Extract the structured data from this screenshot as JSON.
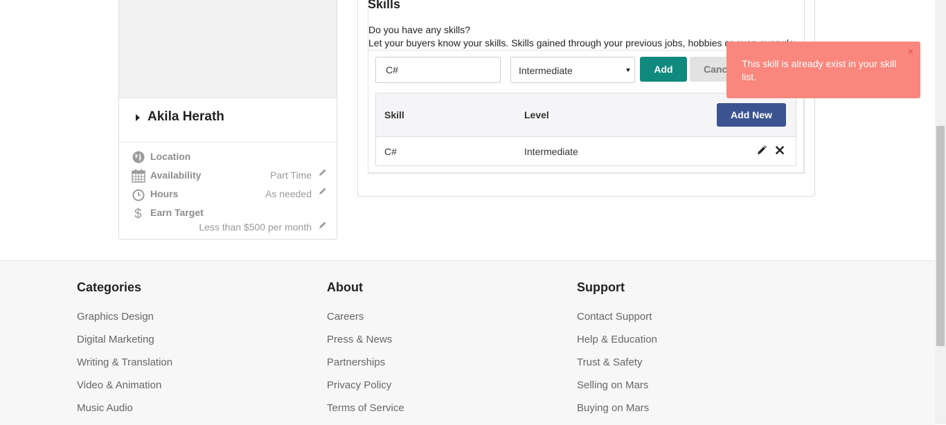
{
  "profile": {
    "name": "Akila Herath",
    "location_label": "Location",
    "availability_label": "Availability",
    "availability_value": "Part Time",
    "hours_label": "Hours",
    "hours_value": "As needed",
    "earn_label": "Earn Target",
    "earn_value": "Less than $500 per month"
  },
  "skills": {
    "title": "Skills",
    "question": "Do you have any skills?",
    "description": "Let your buyers know your skills. Skills gained through your previous jobs, hobbies or even everyday life",
    "input_value": "C#",
    "level_value": "Intermediate",
    "add_label": "Add",
    "cancel_label": "Cancel",
    "table": {
      "headers": [
        "Skill",
        "Level"
      ],
      "add_new_label": "Add New",
      "rows": [
        {
          "skill": "C#",
          "level": "Intermediate"
        }
      ]
    }
  },
  "toast": {
    "message": "This skill is already exist in your skill list.",
    "close": "×",
    "color": "#f9877d"
  },
  "footer": {
    "categories": {
      "title": "Categories",
      "items": [
        "Graphics Design",
        "Digital Marketing",
        "Writing & Translation",
        "Video & Animation",
        "Music Audio"
      ]
    },
    "about": {
      "title": "About",
      "items": [
        "Careers",
        "Press & News",
        "Partnerships",
        "Privacy Policy",
        "Terms of Service"
      ]
    },
    "support": {
      "title": "Support",
      "items": [
        "Contact Support",
        "Help & Education",
        "Trust & Safety",
        "Selling on Mars",
        "Buying on Mars"
      ]
    }
  },
  "colors": {
    "add_button": "#108a7e",
    "add_new_button": "#3b5491",
    "toast": "#f9877d"
  }
}
